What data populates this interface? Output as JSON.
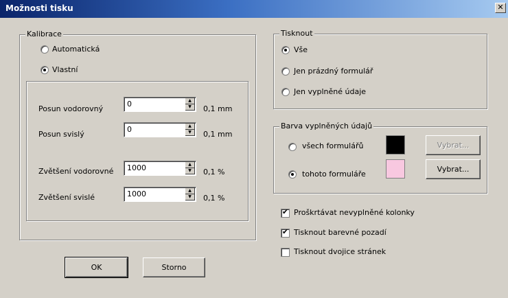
{
  "window": {
    "title": "Možnosti tisku",
    "close_glyph": "✕"
  },
  "calibration": {
    "legend": "Kalibrace",
    "options": [
      {
        "label": "Automatická",
        "selected": false
      },
      {
        "label": "Vlastní",
        "selected": true
      }
    ],
    "fields": [
      {
        "label": "Posun vodorovný",
        "value": "0",
        "unit": "0,1 mm"
      },
      {
        "label": "Posun svislý",
        "value": "0",
        "unit": "0,1 mm"
      },
      {
        "label": "Zvětšení vodorovné",
        "value": "1000",
        "unit": "0,1 %"
      },
      {
        "label": "Zvětšení svislé",
        "value": "1000",
        "unit": "0,1 %"
      }
    ]
  },
  "print": {
    "legend": "Tisknout",
    "options": [
      {
        "label": "Vše",
        "selected": true
      },
      {
        "label": "Jen prázdný formulář",
        "selected": false
      },
      {
        "label": "Jen vyplněné údaje",
        "selected": false
      }
    ]
  },
  "color": {
    "legend": "Barva vyplněných údajů",
    "options": [
      {
        "label": "všech formulářů",
        "selected": false,
        "swatch": "#000000",
        "button": "Vybrat...",
        "enabled": false
      },
      {
        "label": "tohoto formuláře",
        "selected": true,
        "swatch": "#f8c8e0",
        "button": "Vybrat...",
        "enabled": true
      }
    ]
  },
  "checkboxes": [
    {
      "label": "Proškrtávat nevyplněné kolonky",
      "checked": true
    },
    {
      "label": "Tisknout barevné pozadí",
      "checked": true
    },
    {
      "label": "Tisknout dvojice stránek",
      "checked": false
    }
  ],
  "buttons": {
    "ok": "OK",
    "cancel": "Storno"
  },
  "icons": {
    "spin_up": "▲",
    "spin_down": "▼",
    "check": "✔"
  }
}
